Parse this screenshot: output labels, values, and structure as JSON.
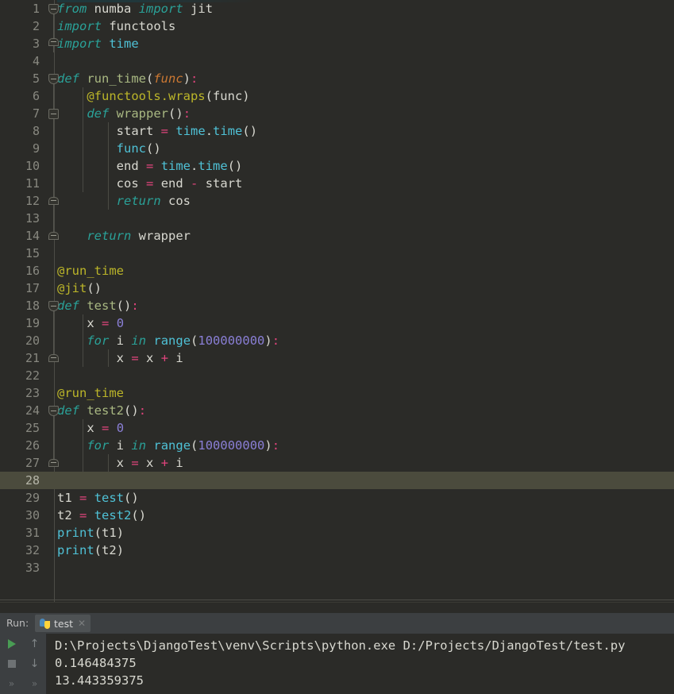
{
  "editor": {
    "language": "python",
    "current_line": 28,
    "total_lines": 33,
    "lines": [
      {
        "n": 1,
        "text": "from numba import jit"
      },
      {
        "n": 2,
        "text": "import functools"
      },
      {
        "n": 3,
        "text": "import time"
      },
      {
        "n": 4,
        "text": ""
      },
      {
        "n": 5,
        "text": "def run_time(func):"
      },
      {
        "n": 6,
        "text": "    @functools.wraps(func)"
      },
      {
        "n": 7,
        "text": "    def wrapper():"
      },
      {
        "n": 8,
        "text": "        start = time.time()"
      },
      {
        "n": 9,
        "text": "        func()"
      },
      {
        "n": 10,
        "text": "        end = time.time()"
      },
      {
        "n": 11,
        "text": "        cos = end - start"
      },
      {
        "n": 12,
        "text": "        return cos"
      },
      {
        "n": 13,
        "text": ""
      },
      {
        "n": 14,
        "text": "    return wrapper"
      },
      {
        "n": 15,
        "text": ""
      },
      {
        "n": 16,
        "text": "@run_time"
      },
      {
        "n": 17,
        "text": "@jit()"
      },
      {
        "n": 18,
        "text": "def test():"
      },
      {
        "n": 19,
        "text": "    x = 0"
      },
      {
        "n": 20,
        "text": "    for i in range(100000000):"
      },
      {
        "n": 21,
        "text": "        x = x + i"
      },
      {
        "n": 22,
        "text": ""
      },
      {
        "n": 23,
        "text": "@run_time"
      },
      {
        "n": 24,
        "text": "def test2():"
      },
      {
        "n": 25,
        "text": "    x = 0"
      },
      {
        "n": 26,
        "text": "    for i in range(100000000):"
      },
      {
        "n": 27,
        "text": "        x = x + i"
      },
      {
        "n": 28,
        "text": ""
      },
      {
        "n": 29,
        "text": "t1 = test()"
      },
      {
        "n": 30,
        "text": "t2 = test2()"
      },
      {
        "n": 31,
        "text": "print(t1)"
      },
      {
        "n": 32,
        "text": "print(t2)"
      },
      {
        "n": 33,
        "text": ""
      }
    ]
  },
  "run_panel": {
    "label": "Run:",
    "tab_name": "test",
    "tab_icon": "python-file-icon",
    "close_icon": "close-icon",
    "buttons": {
      "rerun": "run-icon",
      "stop": "stop-icon",
      "up": "up-arrow-icon",
      "down": "down-arrow-icon",
      "expand_left": "chevrons-icon",
      "expand_right": "chevrons-icon"
    },
    "console": {
      "command": "D:\\Projects\\DjangoTest\\venv\\Scripts\\python.exe D:/Projects/DjangoTest/test.py",
      "output_1": "0.146484375",
      "output_2": "13.443359375"
    }
  },
  "colors": {
    "editor_bg": "#2b2b28",
    "gutter_bg": "#2b2b2b",
    "current_line_bg": "#4b4b3d",
    "panel_bg": "#3c3f41",
    "keyword": "#cc7832",
    "keyword_italic": "#2aa198",
    "decorator": "#bbb529",
    "function": "#a9b882",
    "builtin": "#4fc1d6",
    "number": "#8a7fd6",
    "operator": "#e0447c",
    "text": "#d8d8d0",
    "run_green": "#499c54"
  }
}
